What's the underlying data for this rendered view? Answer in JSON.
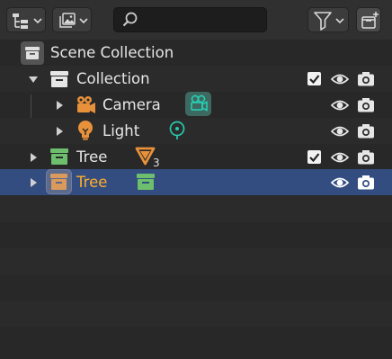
{
  "header": {
    "display_mode_icon": "outliner-tree-icon",
    "filter_icon": "funnel-icon",
    "new_collection_icon": "new-collection-icon",
    "view_layer_icon": "view-layer-images-icon",
    "search": {
      "placeholder": "",
      "value": ""
    }
  },
  "tree": {
    "scene_collection": {
      "label": "Scene Collection",
      "icon": "scene-collection-box-icon"
    },
    "collection": {
      "label": "Collection",
      "icon": "collection-box-icon",
      "expanded": true,
      "exclude_checked": true
    },
    "camera": {
      "label": "Camera",
      "icon": "camera-object-icon",
      "data_icon": "camera-data-icon"
    },
    "light": {
      "label": "Light",
      "icon": "light-bulb-icon",
      "data_icon": "light-data-icon"
    },
    "tree_1": {
      "label": "Tree",
      "icon": "collection-box-green-icon",
      "exclude_checked": true,
      "linked_mesh_icon": "mesh-data-icon",
      "linked_mesh_count": "3"
    },
    "tree_2": {
      "label": "Tree",
      "icon": "collection-instance-icon",
      "selected": true,
      "child_icon": "collection-box-green-icon"
    }
  },
  "colors": {
    "background": "#282828",
    "header": "#303030",
    "selected_row": "#334d80",
    "active_text": "#ffaf29",
    "object_orange": "#e8913b",
    "data_green": "#14a28b",
    "collection_green": "#6dbf6d"
  }
}
